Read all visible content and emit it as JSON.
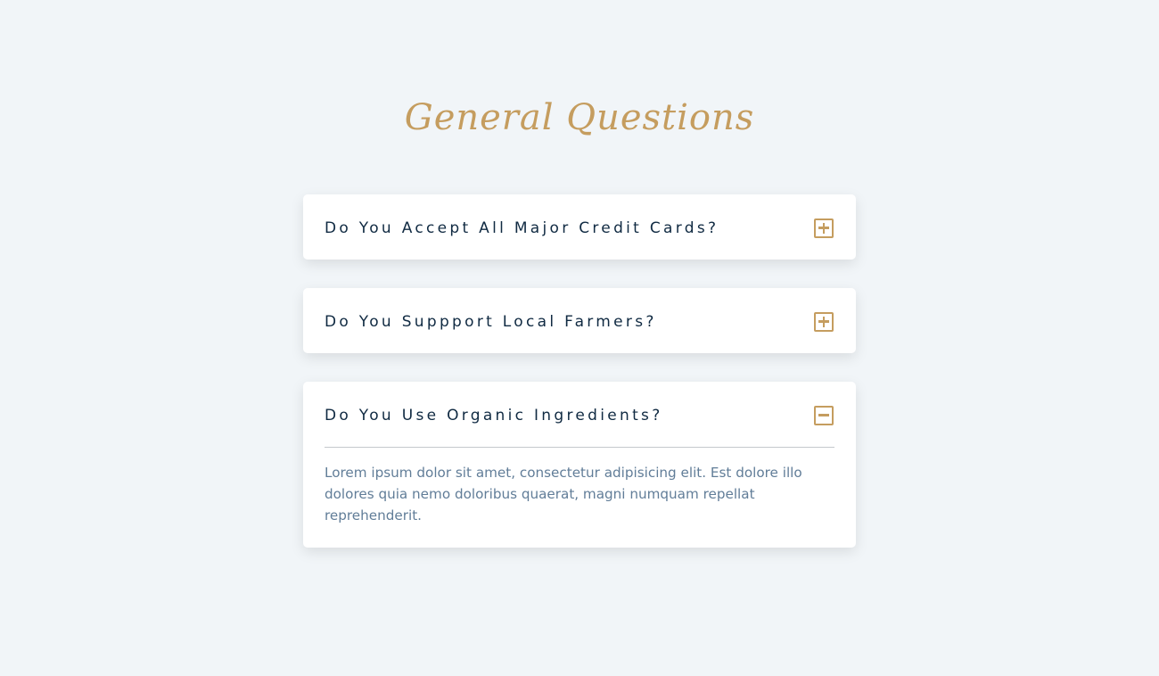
{
  "page": {
    "title": "General Questions"
  },
  "faqs": [
    {
      "question": "Do You Accept All Major Credit Cards?",
      "expanded": false,
      "toggle_icon": "plus-square-icon"
    },
    {
      "question": "Do You Suppport Local Farmers?",
      "expanded": false,
      "toggle_icon": "plus-square-icon"
    },
    {
      "question": "Do You Use Organic Ingredients?",
      "expanded": true,
      "toggle_icon": "minus-square-icon",
      "answer": "Lorem ipsum dolor sit amet, consectetur adipisicing elit. Est dolore illo dolores quia nemo doloribus quaerat, magni numquam repellat reprehenderit."
    }
  ],
  "colors": {
    "background": "#f1f5f8",
    "accent": "#c59d5f",
    "question_text": "#102a42",
    "answer_text": "#617d98",
    "card": "#ffffff"
  }
}
